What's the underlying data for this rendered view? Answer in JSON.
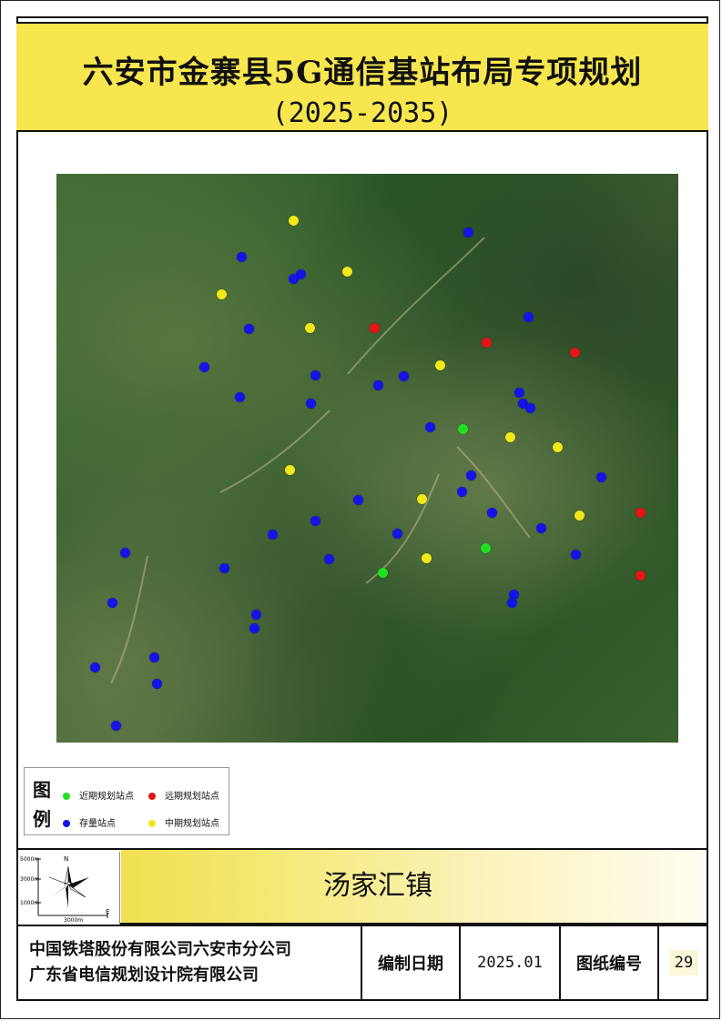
{
  "title": {
    "main": "六安市金寨县5G通信基站布局专项规划",
    "years": "(2025-2035)"
  },
  "colors": {
    "near_term": "#21e021",
    "long_term": "#e41414",
    "existing": "#1414e6",
    "mid_term": "#f0e818",
    "title_bg": "#f7e64e"
  },
  "legend": {
    "title_1": "图",
    "title_2": "例",
    "near_term": "近期规划站点",
    "long_term": "远期规划站点",
    "existing": "存量站点",
    "mid_term": "中期规划站点"
  },
  "scale_bar": {
    "y_labels": [
      "5000m",
      "3000m",
      "1000m"
    ],
    "x_label": "3000m",
    "north": "N",
    "east": "E"
  },
  "town_name": "汤家汇镇",
  "footer": {
    "company_1": "中国铁塔股份有限公司六安市分公司",
    "company_2": "广东省电信规划设计院有限公司",
    "date_label": "编制日期",
    "date_value": "2025.01",
    "drawing_no_label": "图纸编号",
    "drawing_no_value": "29"
  }
}
